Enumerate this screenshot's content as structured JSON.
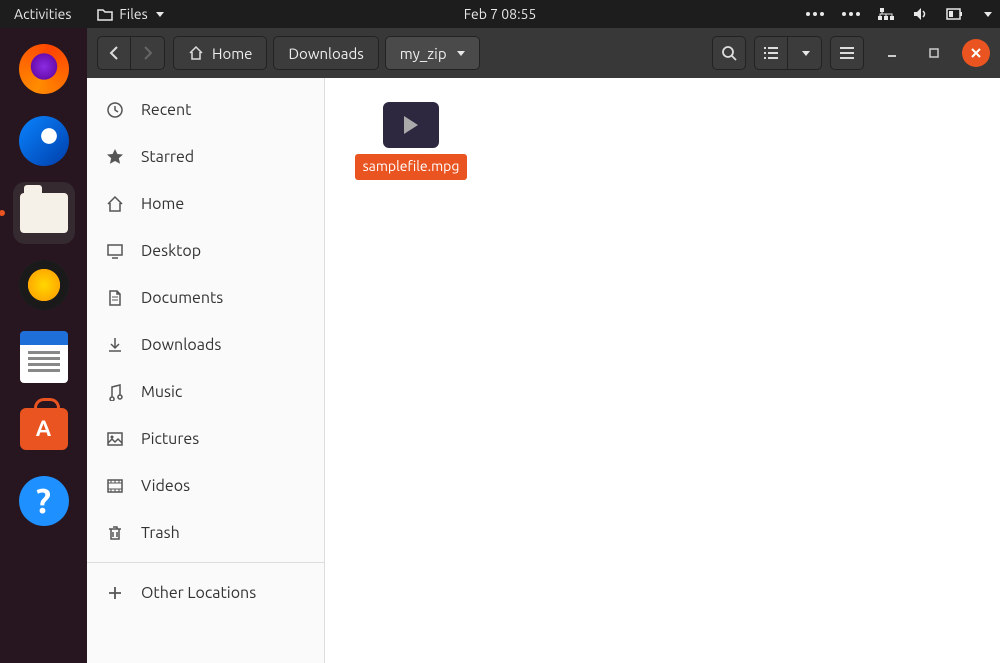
{
  "topbar": {
    "activities": "Activities",
    "app_label": "Files",
    "clock": "Feb 7  08:55"
  },
  "headerbar": {
    "path": [
      {
        "label": "Home",
        "icon": "home"
      },
      {
        "label": "Downloads"
      },
      {
        "label": "my_zip",
        "current": true,
        "dropdown": true
      }
    ]
  },
  "sidebar": {
    "items": [
      {
        "icon": "recent",
        "label": "Recent"
      },
      {
        "icon": "star",
        "label": "Starred"
      },
      {
        "icon": "home",
        "label": "Home"
      },
      {
        "icon": "desktop",
        "label": "Desktop"
      },
      {
        "icon": "documents",
        "label": "Documents"
      },
      {
        "icon": "downloads",
        "label": "Downloads"
      },
      {
        "icon": "music",
        "label": "Music"
      },
      {
        "icon": "pictures",
        "label": "Pictures"
      },
      {
        "icon": "videos",
        "label": "Videos"
      },
      {
        "icon": "trash",
        "label": "Trash"
      }
    ],
    "other": "Other Locations"
  },
  "content": {
    "files": [
      {
        "name": "samplefile.mpg",
        "type": "video",
        "selected": true
      }
    ]
  },
  "dock": {
    "items": [
      {
        "name": "firefox"
      },
      {
        "name": "thunderbird"
      },
      {
        "name": "files",
        "active": true
      },
      {
        "name": "rhythmbox"
      },
      {
        "name": "libreoffice-writer"
      },
      {
        "name": "ubuntu-software"
      },
      {
        "name": "help"
      }
    ]
  }
}
